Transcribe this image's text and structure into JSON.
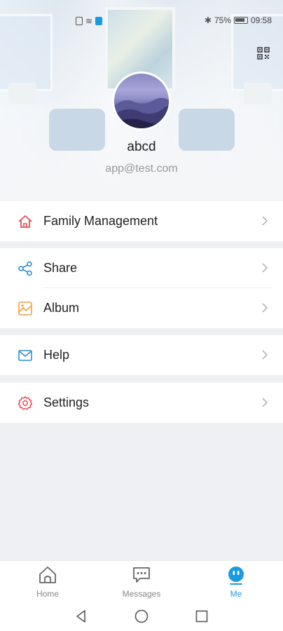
{
  "status_bar": {
    "battery": "75%",
    "time": "09:58"
  },
  "profile": {
    "username": "abcd",
    "email": "app@test.com"
  },
  "menu": {
    "family_management": "Family Management",
    "share": "Share",
    "album": "Album",
    "help": "Help",
    "settings": "Settings"
  },
  "tabs": {
    "home": "Home",
    "messages": "Messages",
    "me": "Me"
  },
  "colors": {
    "accent": "#1a9be0",
    "home_icon": "#e84c55",
    "share_icon": "#2b8fd8",
    "album_icon": "#f0a040",
    "help_icon": "#2b8fd8",
    "settings_icon": "#e84c55"
  }
}
